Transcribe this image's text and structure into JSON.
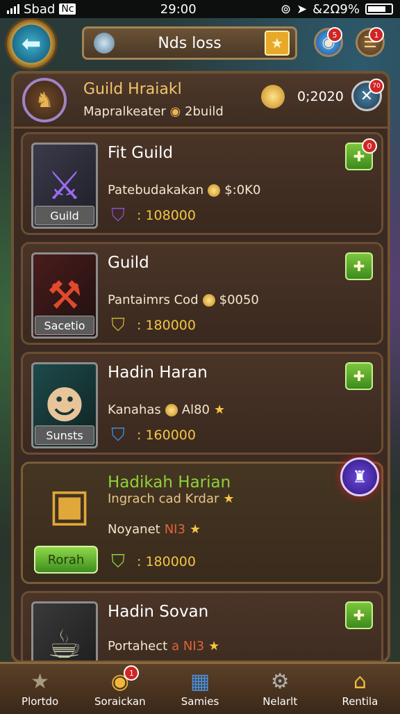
{
  "status_bar": {
    "carrier": "Sbad",
    "badge": "Nc",
    "time": "29:00",
    "battery_text": "&2Ω9%"
  },
  "header": {
    "title": "Nds loss",
    "globe_badge": "5",
    "menu_badge": "1"
  },
  "guild_header": {
    "name": "Guild Hraiakl",
    "subtitle_left": "Mapralkeater",
    "subtitle_right": "2build",
    "score": "0;2020",
    "close_badge": "70"
  },
  "cards": [
    {
      "title": "Fit Guild",
      "tag": "Guild",
      "line1_text": "Patebudakakan",
      "line1_value": "$:0K0",
      "amount": ": 108000",
      "action_badge": "0"
    },
    {
      "title": "Guild",
      "tag": "Sacetio",
      "line1_text": "Pantaimrs Cod",
      "line1_value": "$0050",
      "amount": ": 180000"
    },
    {
      "title": "Hadin Haran",
      "tag": "Sunsts",
      "line1_text": "Kanahas",
      "line1_value": "Al80",
      "amount": ": 160000"
    },
    {
      "title": "Hadikah Harian",
      "subtitle": "Ingrach cad Krdar",
      "line1_text": "Noyanet",
      "line1_value": "NI3",
      "amount": ": 180000",
      "join_label": "Rorah"
    },
    {
      "title": "Hadin Sovan",
      "line1_text": "Portahect",
      "line1_value": "a NI3"
    }
  ],
  "nav": {
    "items": [
      {
        "label": "Plortdo",
        "icon": "star-icon"
      },
      {
        "label": "Soraickan",
        "icon": "coin-icon",
        "badge": "1"
      },
      {
        "label": "Samies",
        "icon": "cube-icon"
      },
      {
        "label": "Nelarlt",
        "icon": "gear-icon"
      },
      {
        "label": "Rentila",
        "icon": "house-icon"
      }
    ]
  },
  "colors": {
    "accent_green": "#8ed33a",
    "gold": "#f4c542",
    "panel_bg": "#3b2a22",
    "notification_red": "#d12424"
  }
}
